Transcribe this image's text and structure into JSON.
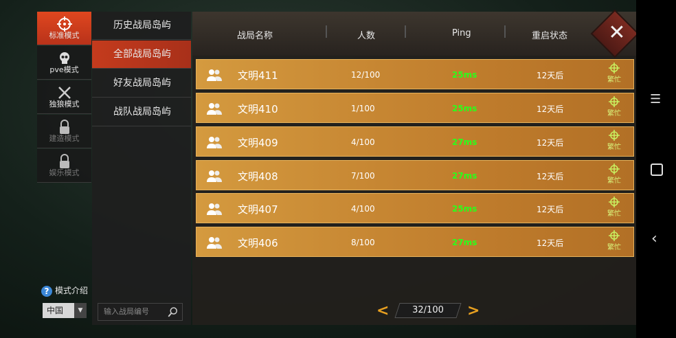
{
  "modes": [
    {
      "label": "标准模式",
      "icon": "crosshair-icon",
      "state": "active"
    },
    {
      "label": "pve模式",
      "icon": "skull-icon",
      "state": "normal"
    },
    {
      "label": "独狼模式",
      "icon": "crossed-swords-icon",
      "state": "normal"
    },
    {
      "label": "建造模式",
      "icon": "lock-icon",
      "state": "locked"
    },
    {
      "label": "娱乐模式",
      "icon": "lock-icon",
      "state": "locked"
    }
  ],
  "submenu": [
    {
      "label": "历史战局岛屿",
      "active": false
    },
    {
      "label": "全部战局岛屿",
      "active": true
    },
    {
      "label": "好友战局岛屿",
      "active": false
    },
    {
      "label": "战队战局岛屿",
      "active": false
    }
  ],
  "table": {
    "headers": {
      "name": "战局名称",
      "count": "人数",
      "ping": "Ping",
      "restart": "重启状态"
    },
    "rows": [
      {
        "name": "文明411",
        "count": "12/100",
        "ping": "25ms",
        "restart": "12天后",
        "status": "繁忙"
      },
      {
        "name": "文明410",
        "count": "1/100",
        "ping": "25ms",
        "restart": "12天后",
        "status": "繁忙"
      },
      {
        "name": "文明409",
        "count": "4/100",
        "ping": "27ms",
        "restart": "12天后",
        "status": "繁忙"
      },
      {
        "name": "文明408",
        "count": "7/100",
        "ping": "27ms",
        "restart": "12天后",
        "status": "繁忙"
      },
      {
        "name": "文明407",
        "count": "4/100",
        "ping": "25ms",
        "restart": "12天后",
        "status": "繁忙"
      },
      {
        "name": "文明406",
        "count": "8/100",
        "ping": "27ms",
        "restart": "12天后",
        "status": "繁忙"
      }
    ]
  },
  "bottom": {
    "intro_label": "模式介绍",
    "region": "中国",
    "search_placeholder": "输入战局编号",
    "page": "32/100"
  },
  "colors": {
    "accent": "#d8421c",
    "row": "#c78733",
    "ping_good": "#2aff1a",
    "pager_arrow": "#e8a020"
  },
  "nav_icons": [
    "menu-icon",
    "home-square-icon",
    "back-chevron-icon"
  ]
}
